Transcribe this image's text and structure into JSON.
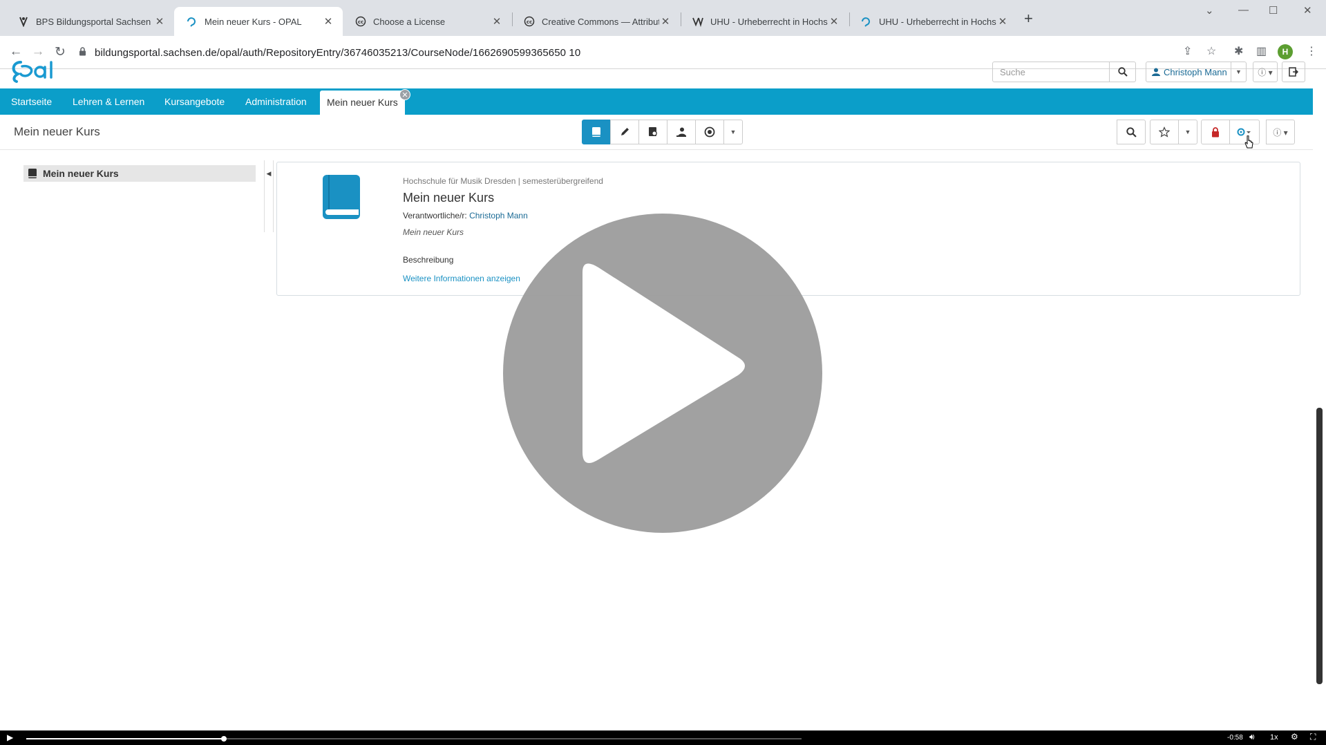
{
  "browser": {
    "tabs": [
      {
        "title": "BPS Bildungsportal Sachsen Gmb",
        "icon": "bps-logo-icon"
      },
      {
        "title": "Mein neuer Kurs - OPAL",
        "icon": "opal-icon",
        "active": true
      },
      {
        "title": "Choose a License",
        "icon": "cc-icon"
      },
      {
        "title": "Creative Commons — Attributio",
        "icon": "cc-icon"
      },
      {
        "title": "UHU - Urheberrecht in Hochschu",
        "icon": "uhu-icon"
      },
      {
        "title": "UHU - Urheberrecht in Hochschu",
        "icon": "opal-icon"
      }
    ],
    "url": "bildungsportal.sachsen.de/opal/auth/RepositoryEntry/36746035213/CourseNode/1662690599365650 10",
    "profile_initial": "H"
  },
  "header": {
    "search_placeholder": "Suche",
    "user_name": "Christoph Mann"
  },
  "nav": {
    "items": [
      "Startseite",
      "Lehren & Lernen",
      "Kursangebote",
      "Administration"
    ],
    "active_tab": "Mein neuer Kurs"
  },
  "course": {
    "page_title": "Mein neuer Kurs",
    "sidebar_item": "Mein neuer Kurs",
    "card": {
      "meta": "Hochschule für Musik Dresden | semesterübergreifend",
      "title": "Mein neuer Kurs",
      "owner_label": "Verantwortliche/r:",
      "owner_name": "Christoph Mann",
      "subtitle": "Mein neuer Kurs",
      "description_label": "Beschreibung",
      "more_link": "Weitere Informationen anzeigen"
    }
  },
  "video": {
    "time": "-0:58",
    "speed": "1x",
    "progress": 0.255
  },
  "colors": {
    "accent": "#0b9ec9",
    "link": "#1a6a95",
    "play_overlay": "#9e9e9e"
  }
}
